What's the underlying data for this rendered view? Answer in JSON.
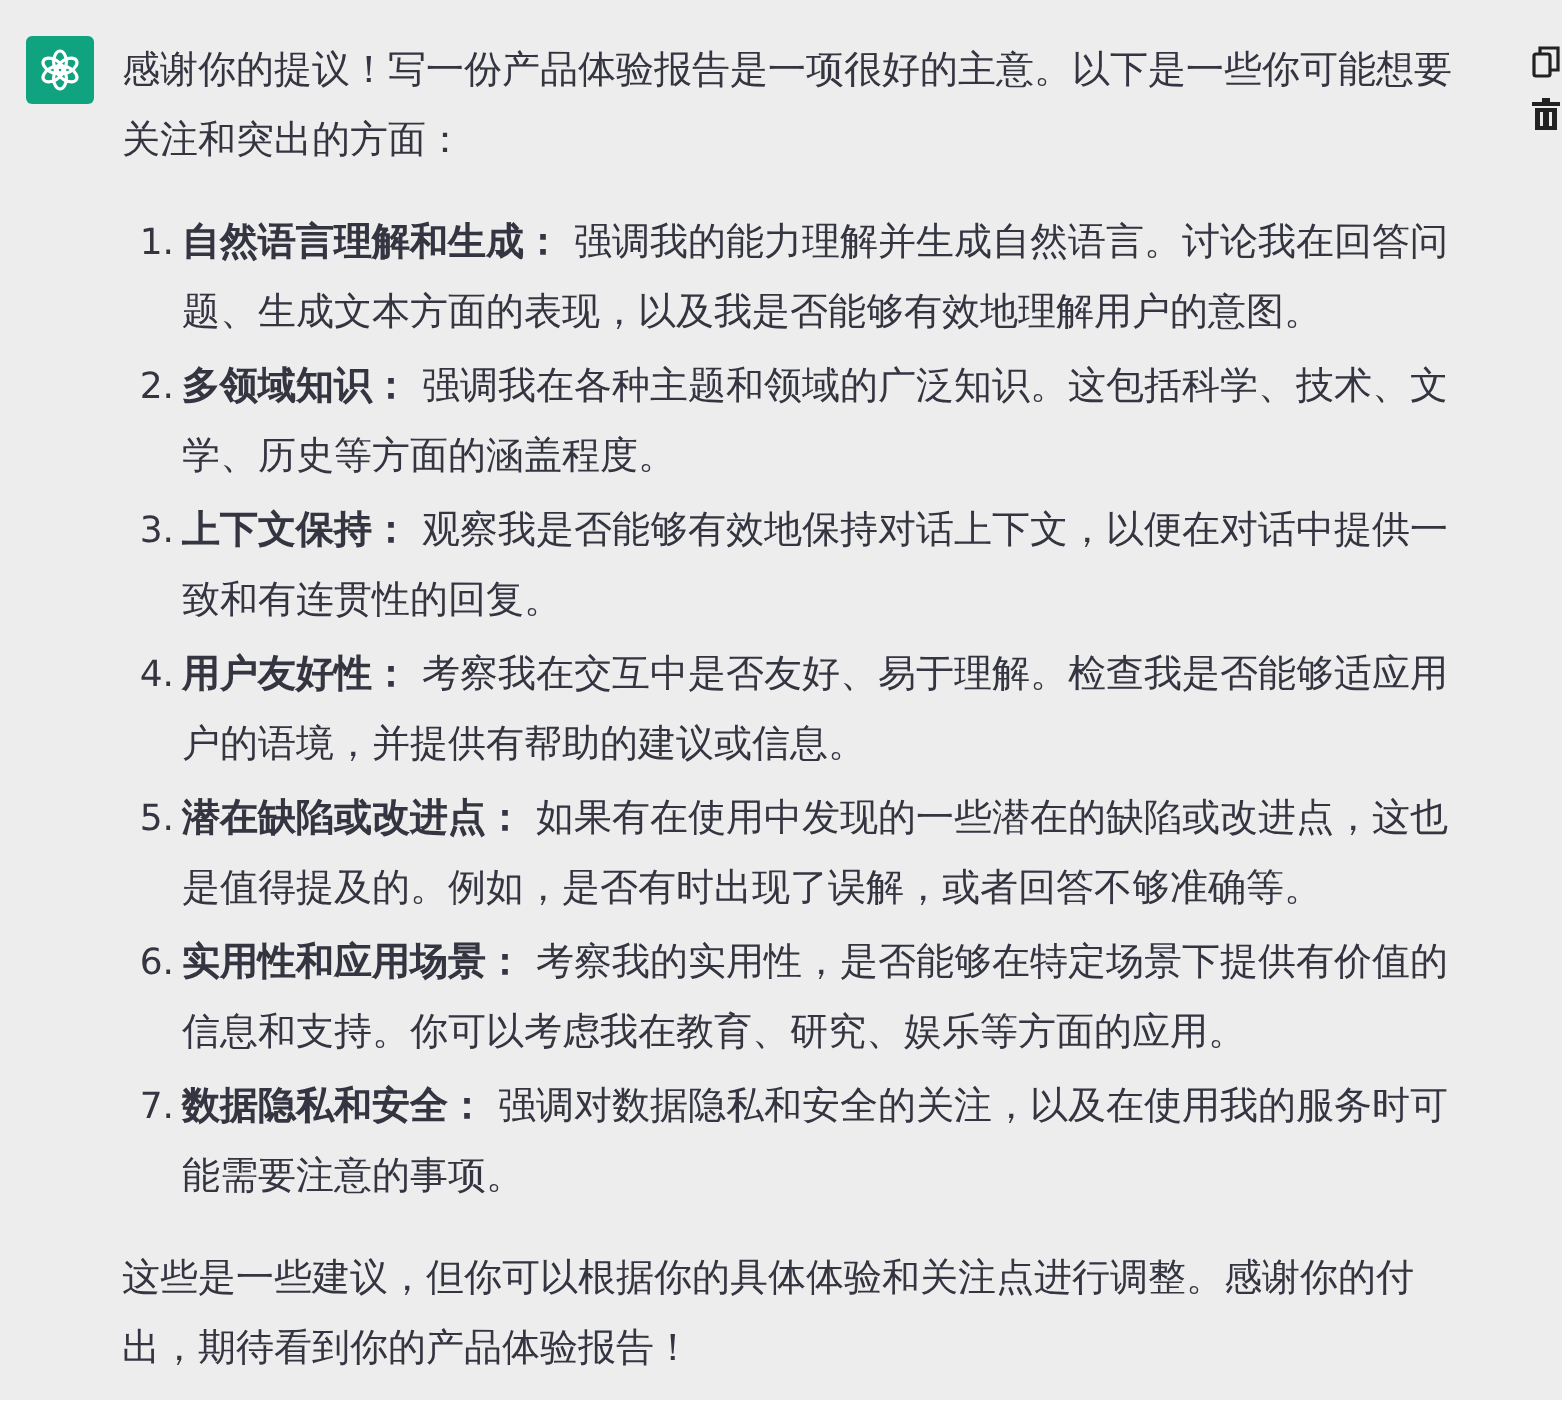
{
  "message": {
    "intro": "感谢你的提议！写一份产品体验报告是一项很好的主意。以下是一些你可能想要关注和突出的方面：",
    "items": [
      {
        "number": "1.",
        "title": "自然语言理解和生成：",
        "text": "强调我的能力理解并生成自然语言。讨论我在回答问题、生成文本方面的表现，以及我是否能够有效地理解用户的意图。"
      },
      {
        "number": "2.",
        "title": "多领域知识：",
        "text": "强调我在各种主题和领域的广泛知识。这包括科学、技术、文学、历史等方面的涵盖程度。"
      },
      {
        "number": "3.",
        "title": "上下文保持：",
        "text": "观察我是否能够有效地保持对话上下文，以便在对话中提供一致和有连贯性的回复。"
      },
      {
        "number": "4.",
        "title": "用户友好性：",
        "text": "考察我在交互中是否友好、易于理解。检查我是否能够适应用户的语境，并提供有帮助的建议或信息。"
      },
      {
        "number": "5.",
        "title": "潜在缺陷或改进点：",
        "text": "如果有在使用中发现的一些潜在的缺陷或改进点，这也是值得提及的。例如，是否有时出现了误解，或者回答不够准确等。"
      },
      {
        "number": "6.",
        "title": "实用性和应用场景：",
        "text": "考察我的实用性，是否能够在特定场景下提供有价值的信息和支持。你可以考虑我在教育、研究、娱乐等方面的应用。"
      },
      {
        "number": "7.",
        "title": "数据隐私和安全：",
        "text": "强调对数据隐私和安全的关注，以及在使用我的服务时可能需要注意的事项。"
      }
    ],
    "outro": "这些是一些建议，但你可以根据你的具体体验和关注点进行调整。感谢你的付出，期待看到你的产品体验报告！"
  }
}
